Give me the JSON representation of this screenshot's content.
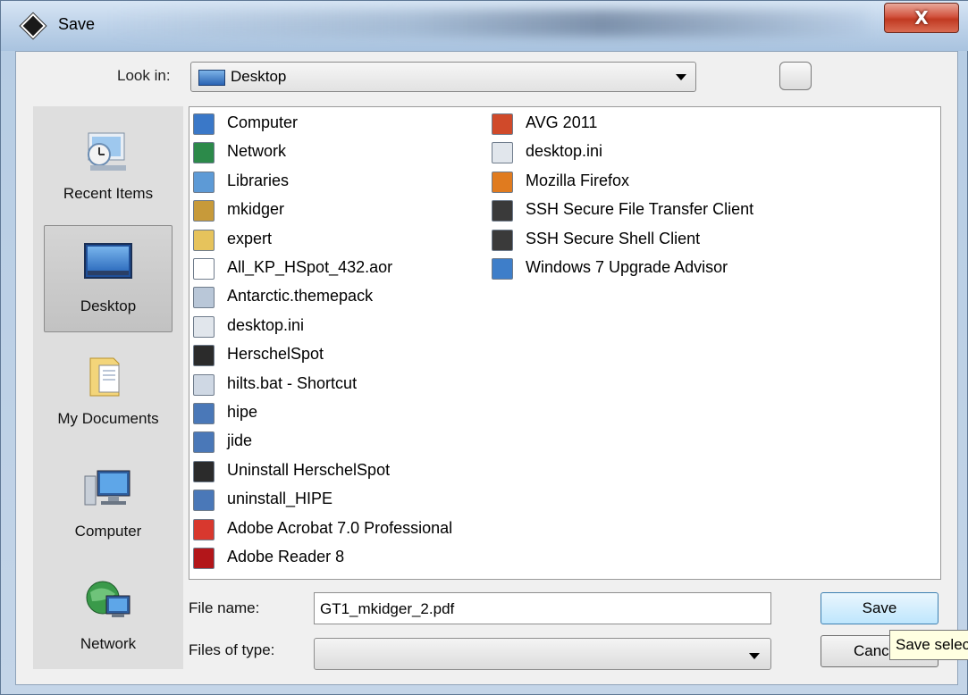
{
  "window": {
    "title": "Save",
    "close_glyph": "X"
  },
  "look_in": {
    "label": "Look in:",
    "value": "Desktop",
    "icon": "desktop-icon"
  },
  "places": [
    {
      "label": "Recent Items",
      "icon": "recent-items-icon",
      "selected": false
    },
    {
      "label": "Desktop",
      "icon": "desktop-icon",
      "selected": true
    },
    {
      "label": "My Documents",
      "icon": "documents-folder-icon",
      "selected": false
    },
    {
      "label": "Computer",
      "icon": "computer-icon",
      "selected": false
    },
    {
      "label": "Network",
      "icon": "network-icon",
      "selected": false
    }
  ],
  "files_col1": [
    {
      "name": "Computer",
      "icon": "computer-icon",
      "color": "#3a78c8"
    },
    {
      "name": "Network",
      "icon": "network-icon",
      "color": "#2c8a4a"
    },
    {
      "name": "Libraries",
      "icon": "library-icon",
      "color": "#5d9ad6"
    },
    {
      "name": "mkidger",
      "icon": "user-folder-icon",
      "color": "#c79a3a"
    },
    {
      "name": "expert",
      "icon": "folder-icon",
      "color": "#e6c35c"
    },
    {
      "name": "All_KP_HSpot_432.aor",
      "icon": "file-icon",
      "color": "#ffffff"
    },
    {
      "name": "Antarctic.themepack",
      "icon": "themepack-icon",
      "color": "#b9c7d8"
    },
    {
      "name": "desktop.ini",
      "icon": "settings-file-icon",
      "color": "#e1e6ec"
    },
    {
      "name": "HerschelSpot",
      "icon": "shortcut-icon",
      "color": "#2b2b2b"
    },
    {
      "name": "hilts.bat - Shortcut",
      "icon": "batch-shortcut-icon",
      "color": "#cfd8e4"
    },
    {
      "name": "hipe",
      "icon": "java-shortcut-icon",
      "color": "#4a78b8"
    },
    {
      "name": "jide",
      "icon": "java-shortcut-icon",
      "color": "#4a78b8"
    },
    {
      "name": "Uninstall HerschelSpot",
      "icon": "shortcut-icon",
      "color": "#2b2b2b"
    },
    {
      "name": "uninstall_HIPE",
      "icon": "java-shortcut-icon",
      "color": "#4a78b8"
    },
    {
      "name": "Adobe Acrobat 7.0 Professional",
      "icon": "acrobat-icon",
      "color": "#d8382e"
    },
    {
      "name": "Adobe Reader 8",
      "icon": "reader-icon",
      "color": "#b3161a"
    }
  ],
  "files_col2": [
    {
      "name": "AVG 2011",
      "icon": "avg-icon",
      "color": "#d04a2a"
    },
    {
      "name": "desktop.ini",
      "icon": "settings-file-icon",
      "color": "#e1e6ec"
    },
    {
      "name": "Mozilla Firefox",
      "icon": "firefox-icon",
      "color": "#e07b1f"
    },
    {
      "name": "SSH Secure File Transfer Client",
      "icon": "ssh-icon",
      "color": "#3a3a3a"
    },
    {
      "name": "SSH Secure Shell Client",
      "icon": "ssh-icon",
      "color": "#3a3a3a"
    },
    {
      "name": "Windows 7 Upgrade Advisor",
      "icon": "windows-shortcut-icon",
      "color": "#3e7ec9"
    }
  ],
  "file_name": {
    "label": "File name:",
    "value": "GT1_mkidger_2.pdf"
  },
  "files_of_type": {
    "label": "Files of type:",
    "value": ""
  },
  "buttons": {
    "save": "Save",
    "cancel": "Cancel"
  },
  "tooltip": "Save selected file"
}
